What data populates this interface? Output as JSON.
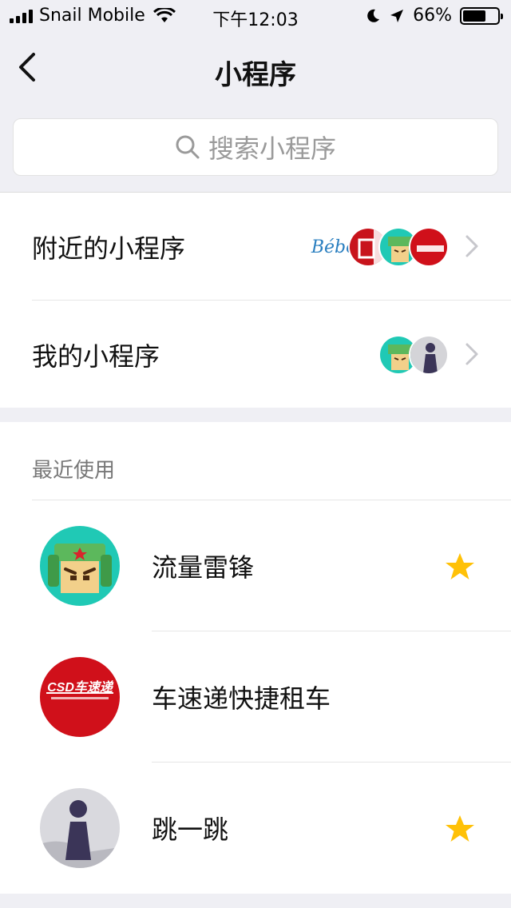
{
  "status_bar": {
    "carrier": "Snail Mobile",
    "time": "下午12:03",
    "battery": "66%",
    "battery_level": 0.66
  },
  "nav": {
    "title": "小程序"
  },
  "search": {
    "placeholder": "搜索小程序"
  },
  "entries": [
    {
      "label": "附近的小程序",
      "thumb_text": "Bébé"
    },
    {
      "label": "我的小程序"
    }
  ],
  "recent": {
    "header": "最近使用",
    "items": [
      {
        "name": "流量雷锋",
        "starred": true
      },
      {
        "name": "车速递快捷租车",
        "starred": false,
        "logo_text": "CSD车速递"
      },
      {
        "name": "跳一跳",
        "starred": true
      }
    ]
  },
  "colors": {
    "star": "#ffc107",
    "csd_red": "#d0101a",
    "teal": "#20c9b5"
  }
}
